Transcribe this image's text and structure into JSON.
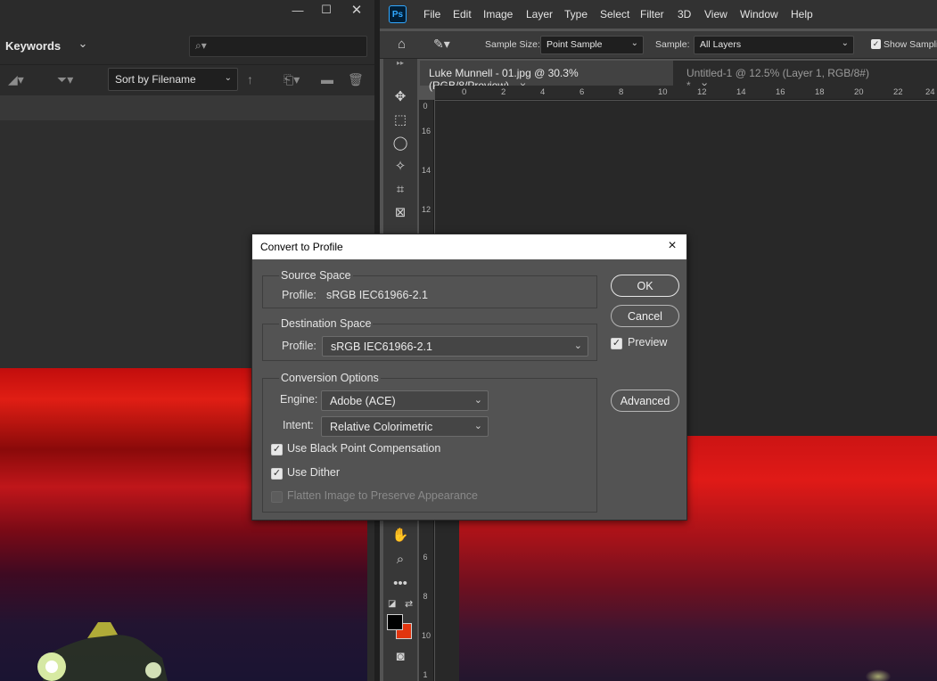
{
  "bridge": {
    "keywords_title": "Keywords",
    "sort_label": "Sort by Filename"
  },
  "photoshop": {
    "logo": "Ps",
    "menu": [
      "File",
      "Edit",
      "Image",
      "Layer",
      "Type",
      "Select",
      "Filter",
      "3D",
      "View",
      "Window",
      "Help"
    ],
    "options": {
      "sample_size_label": "Sample Size:",
      "sample_size_value": "Point Sample",
      "sample_label": "Sample:",
      "sample_value": "All Layers",
      "show_sampling_label": "Show Samplin"
    },
    "tabs": [
      {
        "label": "Luke Munnell - 01.jpg @ 30.3% (RGB/8/Preview)",
        "close": "×"
      },
      {
        "label": "Untitled-1 @ 12.5% (Layer 1, RGB/8#) *",
        "close": "×"
      }
    ],
    "ruler_top": [
      "0",
      "2",
      "4",
      "6",
      "8",
      "10",
      "12",
      "14",
      "16",
      "18",
      "20",
      "22",
      "24"
    ],
    "ruler_left": [
      "0",
      "16",
      "14",
      "12",
      "6",
      "8",
      "10",
      "1"
    ],
    "colors": {
      "foreground": "#000000",
      "background": "#e2350f"
    }
  },
  "dialog": {
    "title": "Convert to Profile",
    "close": "×",
    "source_space": {
      "title": "Source Space",
      "profile_label": "Profile:",
      "profile_value": "sRGB IEC61966-2.1"
    },
    "destination_space": {
      "title": "Destination Space",
      "profile_label": "Profile:",
      "profile_value": "sRGB IEC61966-2.1"
    },
    "conversion_options": {
      "title": "Conversion Options",
      "engine_label": "Engine:",
      "engine_value": "Adobe (ACE)",
      "intent_label": "Intent:",
      "intent_value": "Relative Colorimetric",
      "black_point": {
        "label": "Use Black Point Compensation",
        "checked": true
      },
      "dither": {
        "label": "Use Dither",
        "checked": true
      },
      "flatten": {
        "label": "Flatten Image to Preserve Appearance",
        "checked": false,
        "disabled": true
      }
    },
    "buttons": {
      "ok": "OK",
      "cancel": "Cancel",
      "advanced": "Advanced"
    },
    "preview": {
      "label": "Preview",
      "checked": true
    }
  }
}
